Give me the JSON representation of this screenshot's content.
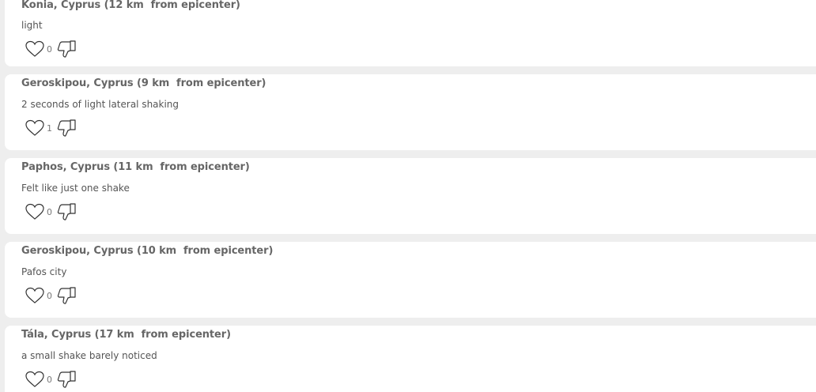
{
  "comments": [
    {
      "title": "Konia, Cyprus (12 km  from epicenter)",
      "text": "light",
      "likes": "0"
    },
    {
      "title": "Geroskipou, Cyprus (9 km  from epicenter)",
      "text": "2 seconds of light lateral shaking",
      "likes": "1"
    },
    {
      "title": "Paphos, Cyprus (11 km  from epicenter)",
      "text": "Felt like just one shake",
      "likes": "0"
    },
    {
      "title": "Geroskipou, Cyprus (10 km  from epicenter)",
      "text": "Pafos city",
      "likes": "0"
    },
    {
      "title": "Tála, Cyprus (17 km  from epicenter)",
      "text": "a small shake barely noticed",
      "likes": "0"
    }
  ],
  "icons": {
    "like": "heart-icon",
    "dislike": "thumbs-down-icon"
  },
  "colors": {
    "background": "#eeeeee",
    "card": "#ffffff",
    "title": "#666666",
    "text": "#555555",
    "icon_stroke": "#333333"
  }
}
